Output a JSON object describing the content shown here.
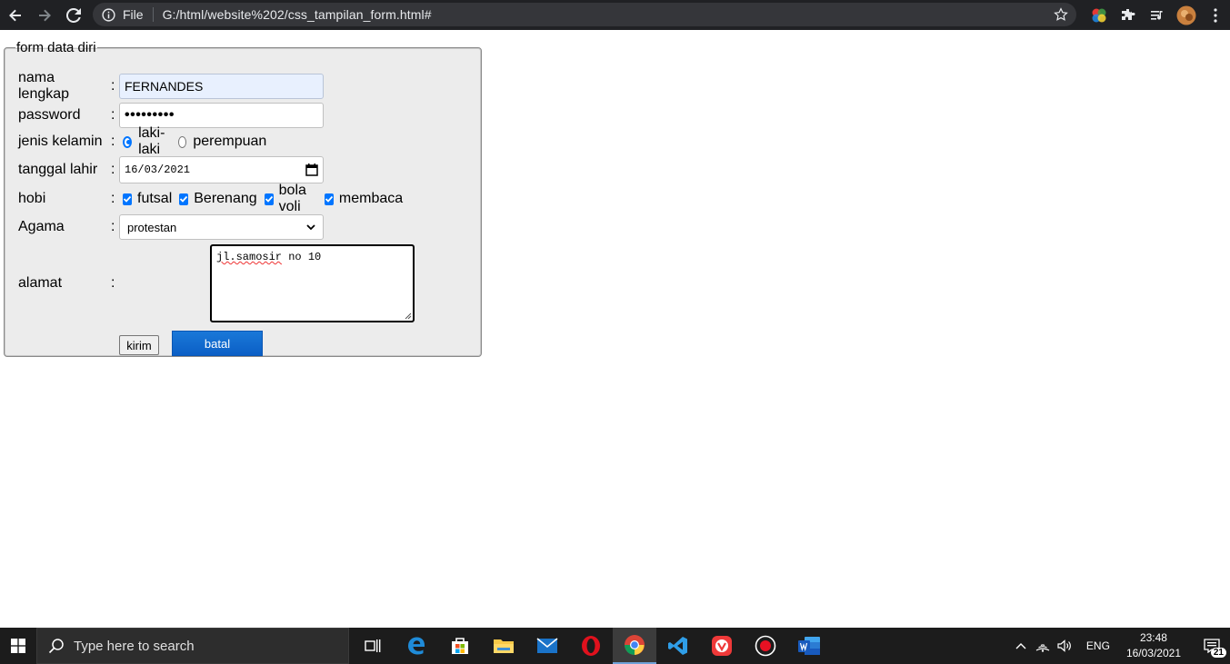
{
  "browser": {
    "file_label": "File",
    "url": "G:/html/website%202/css_tampilan_form.html#"
  },
  "form": {
    "legend": "form data diri",
    "nama": {
      "label": "nama lengkap",
      "value": "FERNANDES"
    },
    "password": {
      "label": "password",
      "masked": "•••••••••"
    },
    "jenis_kelamin": {
      "label": "jenis kelamin",
      "options": [
        "laki-laki",
        "perempuan"
      ],
      "selected": "laki-laki"
    },
    "tanggal_lahir": {
      "label": "tanggal lahir",
      "value": "16/03/2021"
    },
    "hobi": {
      "label": "hobi",
      "options": [
        "futsal",
        "Berenang",
        "bola voli",
        "membaca"
      ],
      "checked": [
        "futsal",
        "Berenang",
        "bola voli",
        "membaca"
      ]
    },
    "agama": {
      "label": "Agama",
      "selected": "protestan"
    },
    "alamat": {
      "label": "alamat",
      "value_word1": "jl.samosir",
      "value_rest": " no 10"
    },
    "colon": ":",
    "submit_label": "kirim",
    "cancel_label": "batal"
  },
  "taskbar": {
    "search_placeholder": "Type here to search",
    "language": "ENG",
    "time": "23:48",
    "date": "16/03/2021",
    "notification_count": "21",
    "apps": [
      "task-view-icon",
      "edge-icon",
      "store-icon",
      "file-explorer-icon",
      "mail-icon",
      "opera-icon",
      "chrome-icon",
      "vscode-icon",
      "vivaldi-icon",
      "recorder-icon",
      "word-icon"
    ]
  },
  "colors": {
    "accent": "#0075ff",
    "batal_button": "#0b5fc6",
    "chrome_dark": "#202124",
    "form_bg": "#ececec"
  }
}
